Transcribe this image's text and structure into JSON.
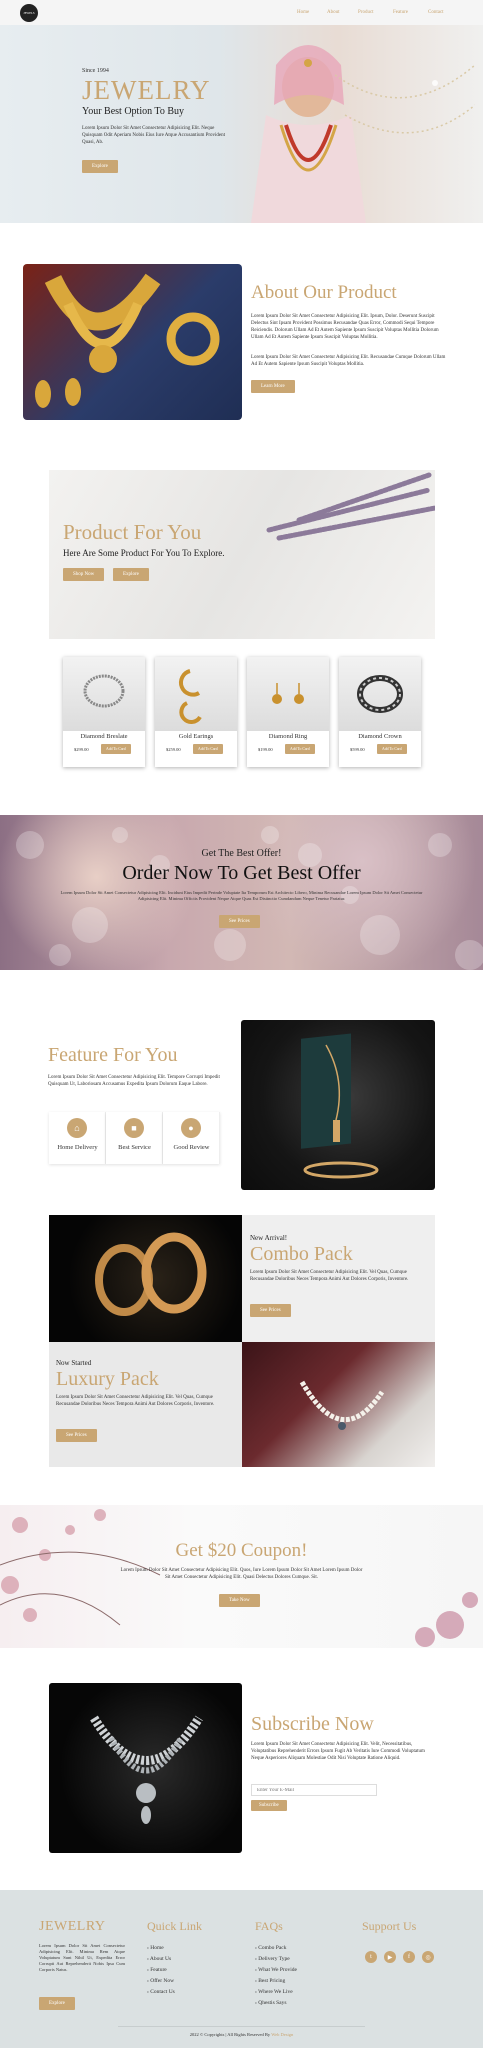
{
  "nav": {
    "logo_text": "JEWELS",
    "links": [
      "Home",
      "About",
      "Product",
      "Feature",
      "Contact"
    ],
    "accent": "#c9a673"
  },
  "hero": {
    "since": "Since 1994",
    "title": "JEWELRY",
    "subtitle": "Your Best Option To Buy",
    "text": "Lorem Ipsum Dolor Sit Amet Consectetur Adipisicing Elit. Neque Quisquam Odit Aperiam Nobis Eius Iure Atque Accusantium Provident Quasi, Ab.",
    "button": "Explore"
  },
  "about": {
    "title": "About Our Product",
    "p1": "Lorem Ipsum Dolor Sit Amet Consectetur Adipisicing Elit. Ipsum, Dolor. Deserunt Suscipit Delectus Sint Ipsam Provident Possimus Recusandae Quas Error, Commodi Sequi Tempore Reiciendis. Dolorum Ullam Ad Et Autem Sapiente Ipsum Suscipit Voluptas Mollitia Dolorum Ullam Ad Et Autem Sapiente Ipsum Suscipit Voluptas Mollitia.",
    "p2": "Lorem Ipsum Dolor Sit Amet Consectetur Adipisicing Elit. Recusandae Cumque Dolorum Ullam Ad Et Autem Sapiente Ipsum Suscipit Voluptas Mollitia.",
    "button": "Learn More"
  },
  "products_banner": {
    "title": "Product For You",
    "subtitle": "Here Are Some Product For You To Explore.",
    "btn1": "Shop Now",
    "btn2": "Explore"
  },
  "products": [
    {
      "name": "Diamond Breslate",
      "price": "$299.00",
      "button": "Add To Card"
    },
    {
      "name": "Gold Earings",
      "price": "$259.00",
      "button": "Add To Card"
    },
    {
      "name": "Diamond Ring",
      "price": "$199.00",
      "button": "Add To Card"
    },
    {
      "name": "Diamond Crown",
      "price": "$599.00",
      "button": "Add To Card"
    }
  ],
  "offer": {
    "kicker": "Get The Best Offer!",
    "title": "Order Now To Get Best Offer",
    "text": "Lorem Ipsum Dolor Sit Amet Consectetur Adipisicing Elit. Incidunt Eius Impedit Perinde Voluptate Ita Temporum Est Architecto Libero, Minima Recusandae Lorem Ipsum Dolor Sit Amet Consectetur Adipisicing Elit. Minima Officiis Provident Neque Atque Quas Est Distinctio Cumdandum Neque Tenetur Pariatur.",
    "button": "See Prices"
  },
  "feature": {
    "title": "Feature For You",
    "text": "Lorem Ipsum Dolor Sit Amet Consectetur Adipisicing Elit. Tempore Corrupti Impedit Quisquam Ut, Laboriosam Accusamus Expedita Ipsum Dolorum Eaque Labore.",
    "boxes": [
      {
        "label": "Home Delivery",
        "icon": "home-icon"
      },
      {
        "label": "Best Service",
        "icon": "truck-icon"
      },
      {
        "label": "Good Review",
        "icon": "user-icon"
      }
    ]
  },
  "combo": {
    "kicker": "New Arrival!",
    "title": "Combo Pack",
    "text": "Lorem Ipsum Dolor Sit Amet Consectetur Adipisicing Elit. Vel Quas, Cumque Recusandae Doloribus Neces Tempora Animi Aut Dolores Corporis, Inventore.",
    "button": "See Prices"
  },
  "luxury": {
    "kicker": "Now Started",
    "title": "Luxury Pack",
    "text": "Lorem Ipsum Dolor Sit Amet Consectetur Adipisicing Elit. Vel Quas, Cumque Recusandae Doloribus Neces Tempora Animi Aut Dolores Corporis, Inventore.",
    "button": "See Prices"
  },
  "coupon": {
    "title": "Get $20 Coupon!",
    "text": "Lorem Ipsum Dolor Sit Amet Consectetur Adipisicing Elit. Quos, Iure Lorem Ipsum Dolor Sit Amet Lorem Ipsum Dolor Sit Amet Consectetur Adipisicing Elit. Quasi Delectus Dolores Cumque. Sit.",
    "button": "Take Now"
  },
  "subscribe": {
    "title": "Subscribe Now",
    "text": "Lorem Ipsum Dolor Sit Amet Consectetur Adipisicing Elit. Velit, Necessitatibus, Voluptatibus Reprehenderit Errors Ipsum Fugit Ab Veritatis Iure Commodi Voluptatum Neque Asperiores Aliquam Molestiae Odit Nisi Voluptate Ratione Aliquid.",
    "placeholder": "Enter Your E-Mail",
    "button": "Subscribe"
  },
  "footer": {
    "brand": "JEWELRY",
    "brand_text": "Lorem Ipsum Dolor Sit Amet Consectetur Adipisicing Elit. Minima Rem Atque Voluptatum Sunt Nihil Ut, Expedita Error Corrupti Aut Reprehenderit Nobis Ipsa Cum Corporis Natus.",
    "brand_button": "Explore",
    "quick_title": "Quick Link",
    "quick_links": [
      "Home",
      "About Us",
      "Feature",
      "Offer Now",
      "Contact Us"
    ],
    "faq_title": "FAQs",
    "faq_links": [
      "Combo Pack",
      "Delivery Type",
      "What We Provide",
      "Best Pricing",
      "Where We Live",
      "Qhestis Says"
    ],
    "support_title": "Support Us",
    "social_icons": [
      "twitter-icon",
      "youtube-icon",
      "facebook-icon",
      "instagram-icon"
    ],
    "copyright": "2022 © Copyrights | All Rights Reserved By",
    "copyright_link": "Web Design"
  }
}
